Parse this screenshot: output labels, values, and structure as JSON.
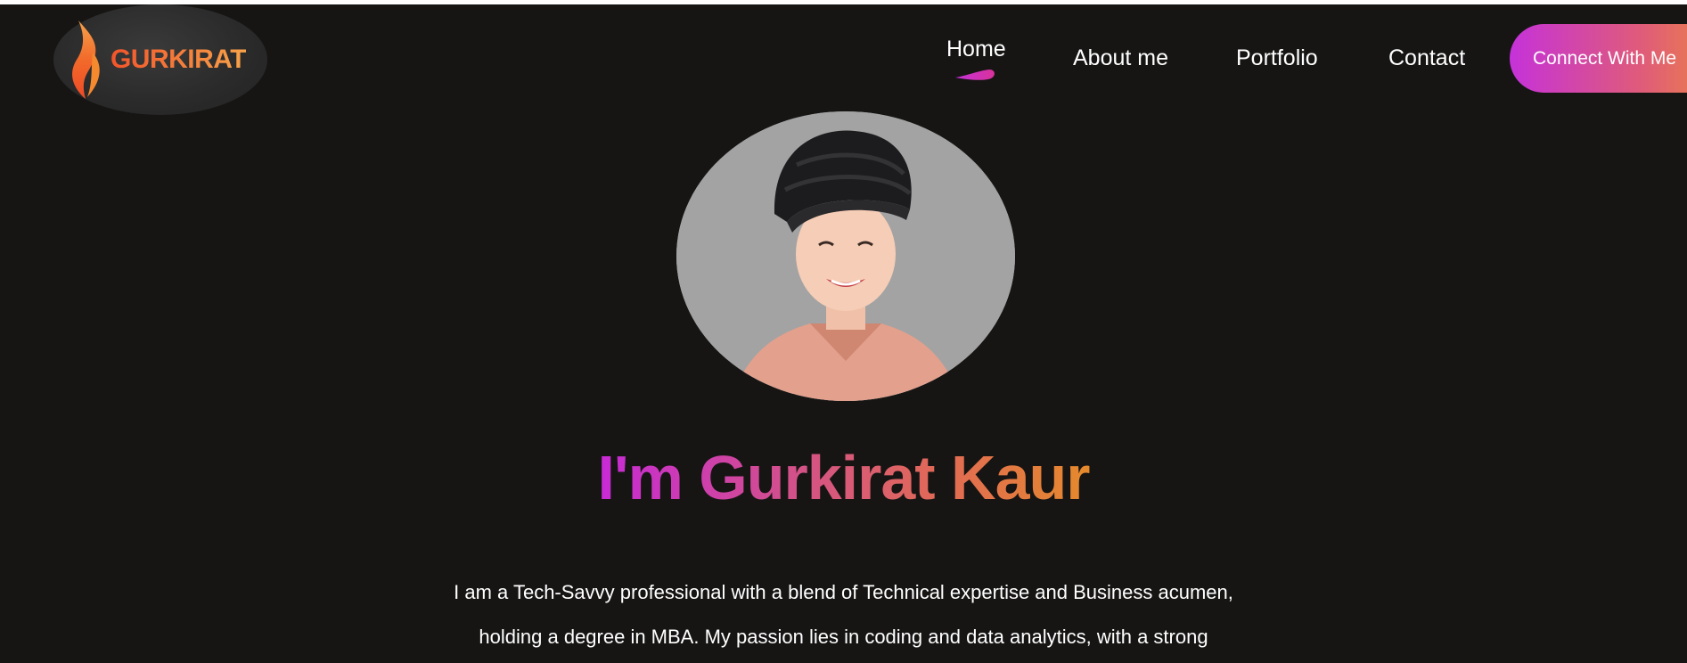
{
  "logo": {
    "text": "GURKIRAT",
    "icon": "flame-icon"
  },
  "nav": {
    "items": [
      {
        "label": "Home",
        "active": true
      },
      {
        "label": "About me",
        "active": false
      },
      {
        "label": "Portfolio",
        "active": false
      },
      {
        "label": "Contact",
        "active": false
      }
    ],
    "cta_label": "Connect With Me"
  },
  "hero": {
    "avatar": "profile-photo",
    "title": "I'm Gurkirat Kaur",
    "bio_lines": [
      "I am a Tech-Savvy professional with a blend of Technical expertise and Business acumen,",
      "holding a degree in MBA. My passion lies in coding and data analytics, with a strong"
    ]
  },
  "colors": {
    "background": "#161514",
    "accent_start": "#c532d9",
    "accent_end": "#ec8443",
    "logo_orange": "#f2552a"
  }
}
